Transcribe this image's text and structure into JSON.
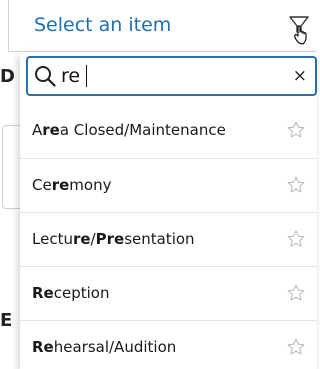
{
  "select": {
    "placeholder": "Select an item",
    "icon": "funnel-icon"
  },
  "search": {
    "value": "re",
    "clear_glyph": "×",
    "icon": "search-icon"
  },
  "background": {
    "letter_top": "D",
    "letter_bottom": "E"
  },
  "options": [
    {
      "parts": [
        [
          "",
          "A"
        ],
        [
          "b",
          "re"
        ],
        [
          "",
          "a Closed/Maintenance"
        ]
      ],
      "full_label": "Area Closed/Maintenance",
      "favorite": false
    },
    {
      "parts": [
        [
          "",
          "Ce"
        ],
        [
          "b",
          "re"
        ],
        [
          "",
          "mony"
        ]
      ],
      "full_label": "Ceremony",
      "favorite": false
    },
    {
      "parts": [
        [
          "",
          "Lectu"
        ],
        [
          "b",
          "re"
        ],
        [
          "",
          "/"
        ],
        [
          "b",
          "Pre"
        ],
        [
          "",
          "sentation"
        ]
      ],
      "full_label": "Lecture/Presentation",
      "favorite": false
    },
    {
      "parts": [
        [
          "b",
          "Re"
        ],
        [
          "",
          "ception"
        ]
      ],
      "full_label": "Reception",
      "favorite": false
    },
    {
      "parts": [
        [
          "b",
          "Re"
        ],
        [
          "",
          "hearsal/Audition"
        ]
      ],
      "full_label": "Rehearsal/Audition",
      "favorite": false
    }
  ],
  "colors": {
    "accent": "#2b6fa9",
    "placeholder_text": "#1f6fad",
    "star_outline": "#b5b5b5"
  }
}
